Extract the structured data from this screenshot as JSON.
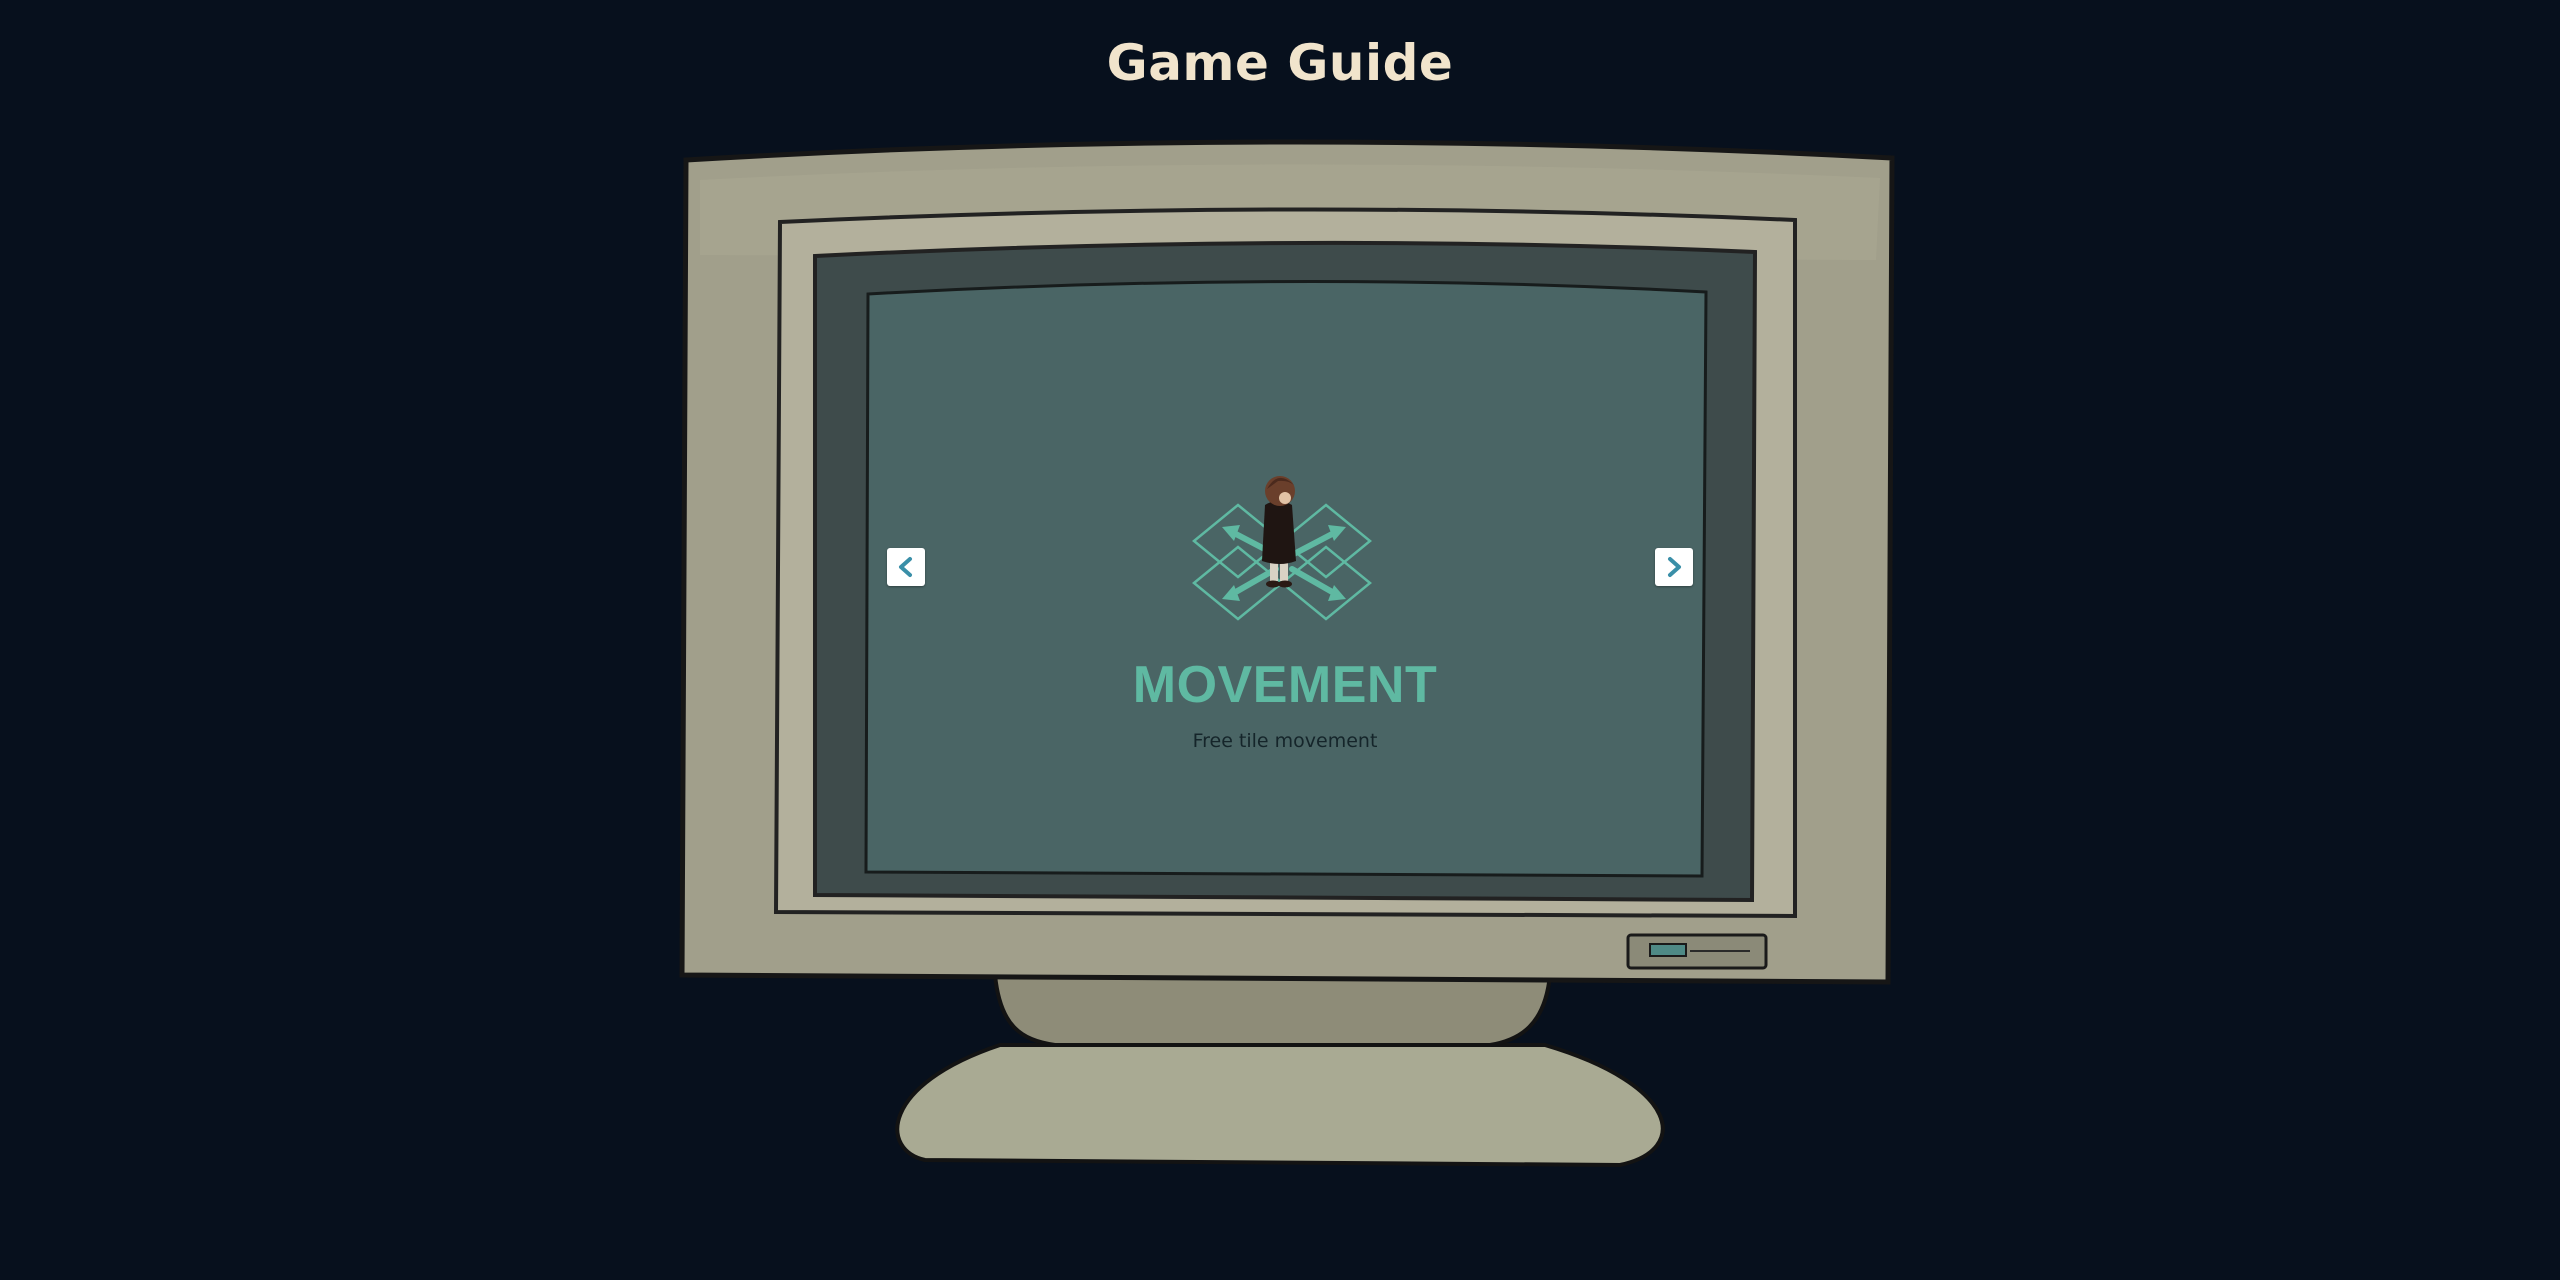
{
  "header": {
    "title": "Game Guide"
  },
  "guide": {
    "slide": {
      "title": "MOVEMENT",
      "description": "Free tile movement",
      "illustration": "tile-movement-character"
    },
    "navigation": {
      "prev_icon": "chevron-left-icon",
      "next_icon": "chevron-right-icon"
    }
  },
  "colors": {
    "background": "#07101d",
    "title_text": "#f1e4cc",
    "screen": "#4a6565",
    "accent": "#5fb9a2",
    "monitor_body": "#9c9a86"
  }
}
